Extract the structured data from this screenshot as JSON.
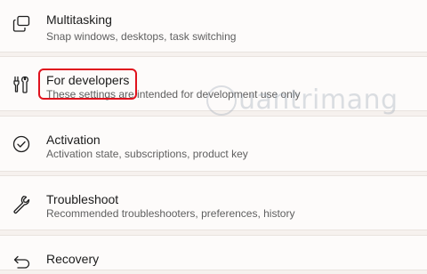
{
  "settings_items": [
    {
      "title": "Multitasking",
      "description": "Snap windows, desktops, task switching",
      "icon": "multitasking-icon"
    },
    {
      "title": "For developers",
      "description": "These settings are intended for development use only",
      "icon": "developer-tools-icon"
    },
    {
      "title": "Activation",
      "description": "Activation state, subscriptions, product key",
      "icon": "check-circle-icon"
    },
    {
      "title": "Troubleshoot",
      "description": "Recommended troubleshooters, preferences, history",
      "icon": "wrench-icon"
    },
    {
      "title": "Recovery",
      "description": "",
      "icon": "recovery-icon"
    }
  ],
  "annotation": {
    "color": "#e0121d",
    "highlighted_item": "For developers"
  },
  "watermark": {
    "text": "uantrimang"
  }
}
